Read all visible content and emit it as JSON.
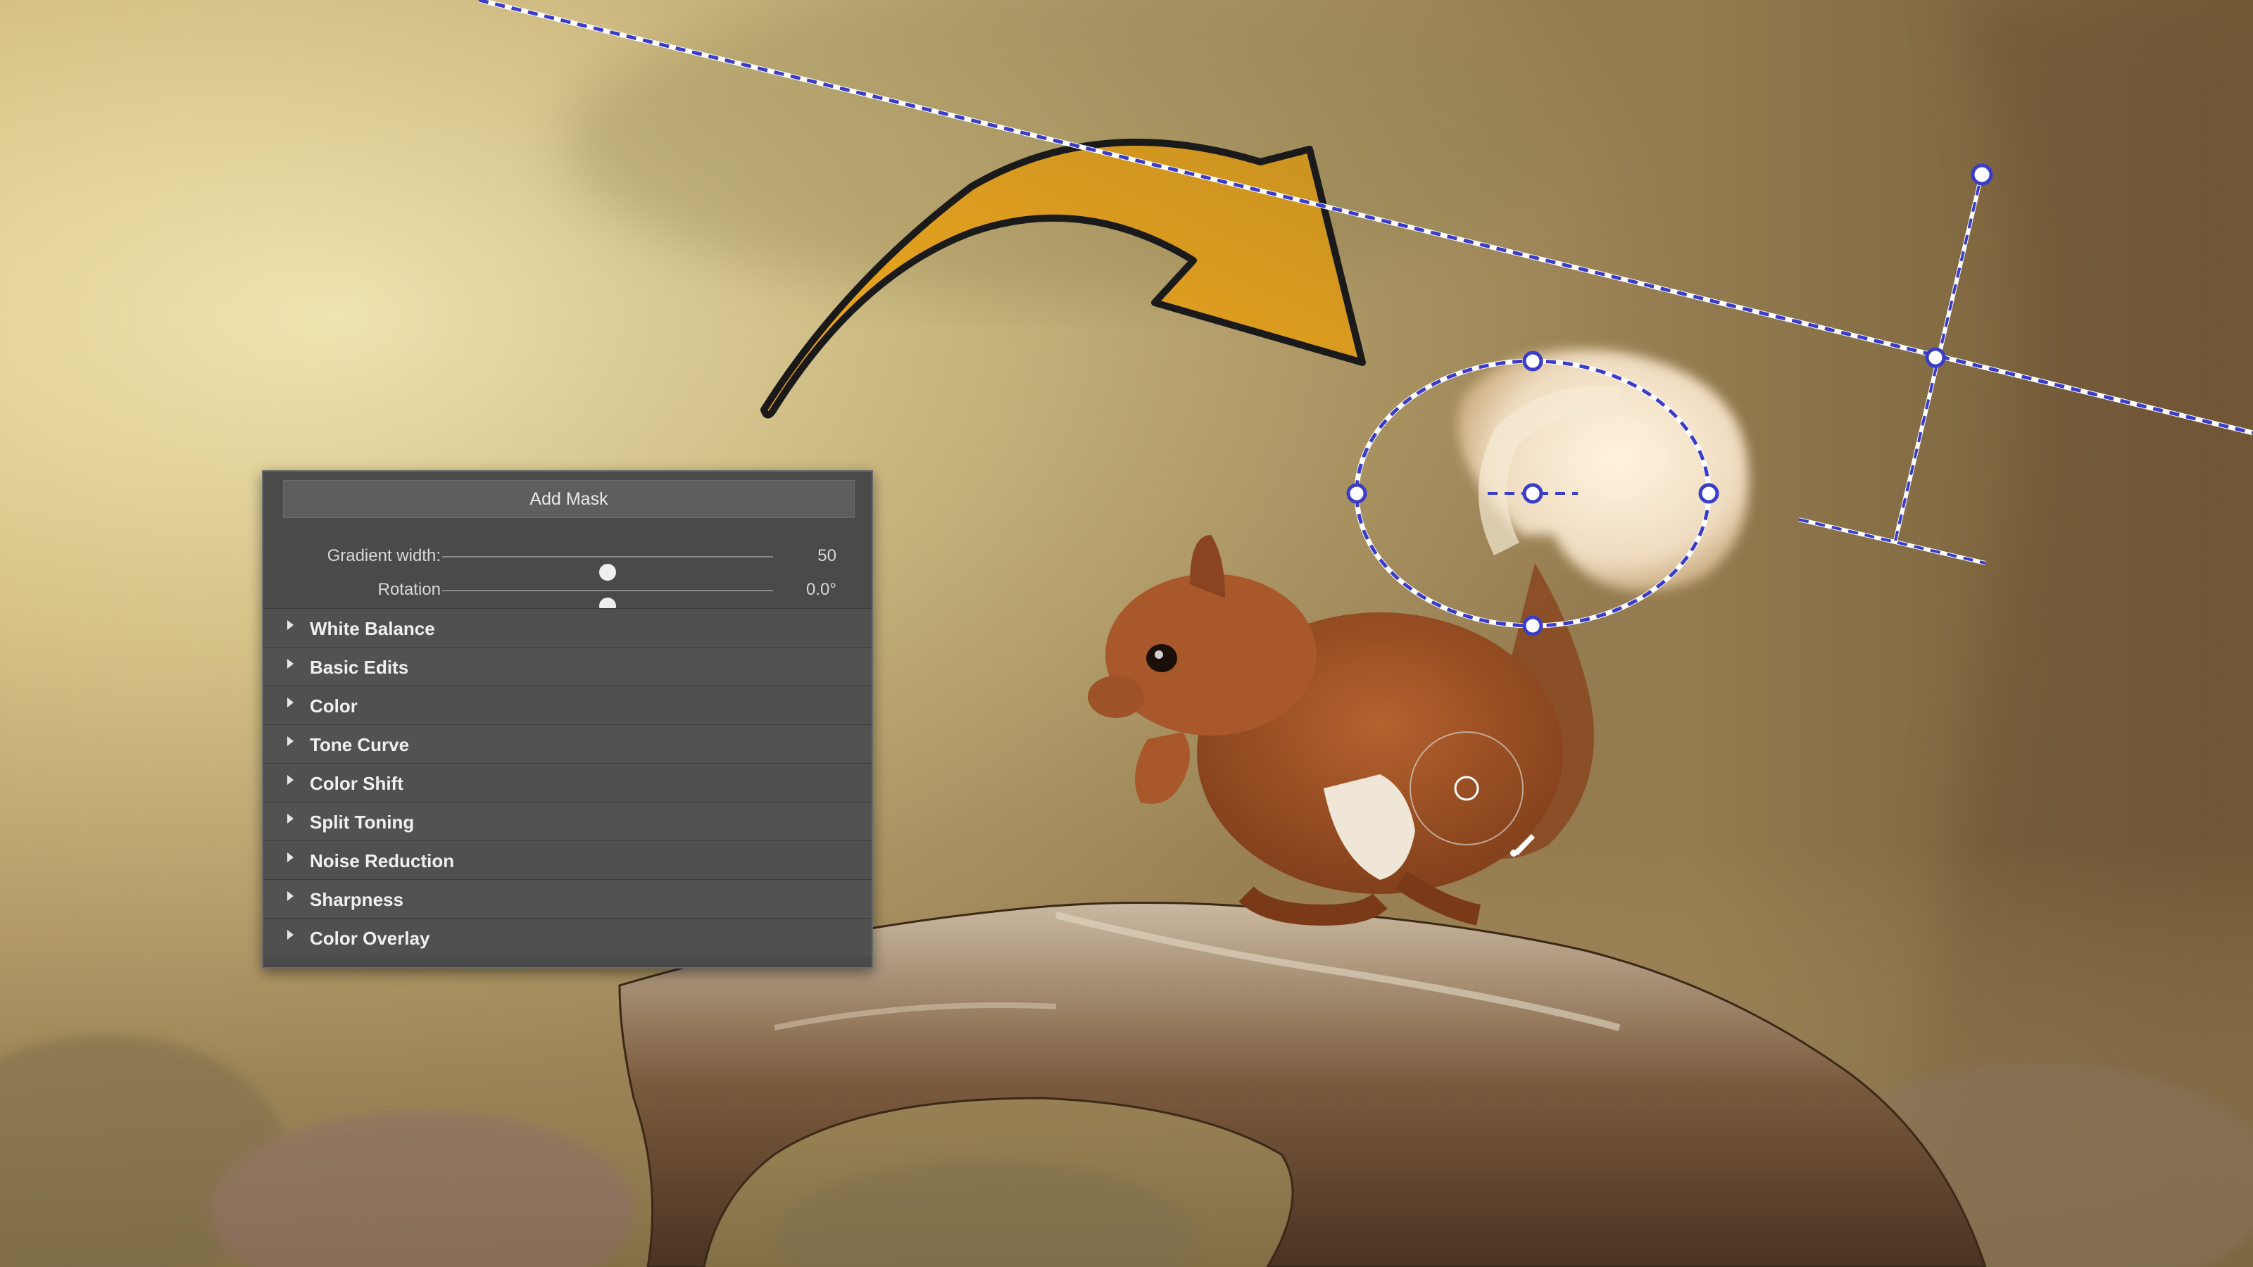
{
  "mask_panel": {
    "add_mask_label": "Add Mask",
    "gradient_width": {
      "label": "Gradient width:",
      "value": "50",
      "level": 0.5
    },
    "rotation": {
      "label": "Rotation",
      "value": "0.0°",
      "level": 0.5
    },
    "sections": [
      {
        "label": "White Balance"
      },
      {
        "label": "Basic Edits"
      },
      {
        "label": "Color"
      },
      {
        "label": "Tone Curve"
      },
      {
        "label": "Color Shift"
      },
      {
        "label": "Split Toning"
      },
      {
        "label": "Noise Reduction"
      },
      {
        "label": "Sharpness"
      },
      {
        "label": "Color Overlay"
      }
    ]
  },
  "colors": {
    "mask_outline": "#3b3cc8",
    "arrow_fill": "#e5a42a",
    "panel_bg": "#4a4a4a"
  },
  "icons": {
    "arrow": "curved-arrow-icon",
    "brush": "brush-cursor-icon",
    "ellipse_mask": "radial-mask-ellipse",
    "linear_mask": "linear-gradient-mask"
  }
}
